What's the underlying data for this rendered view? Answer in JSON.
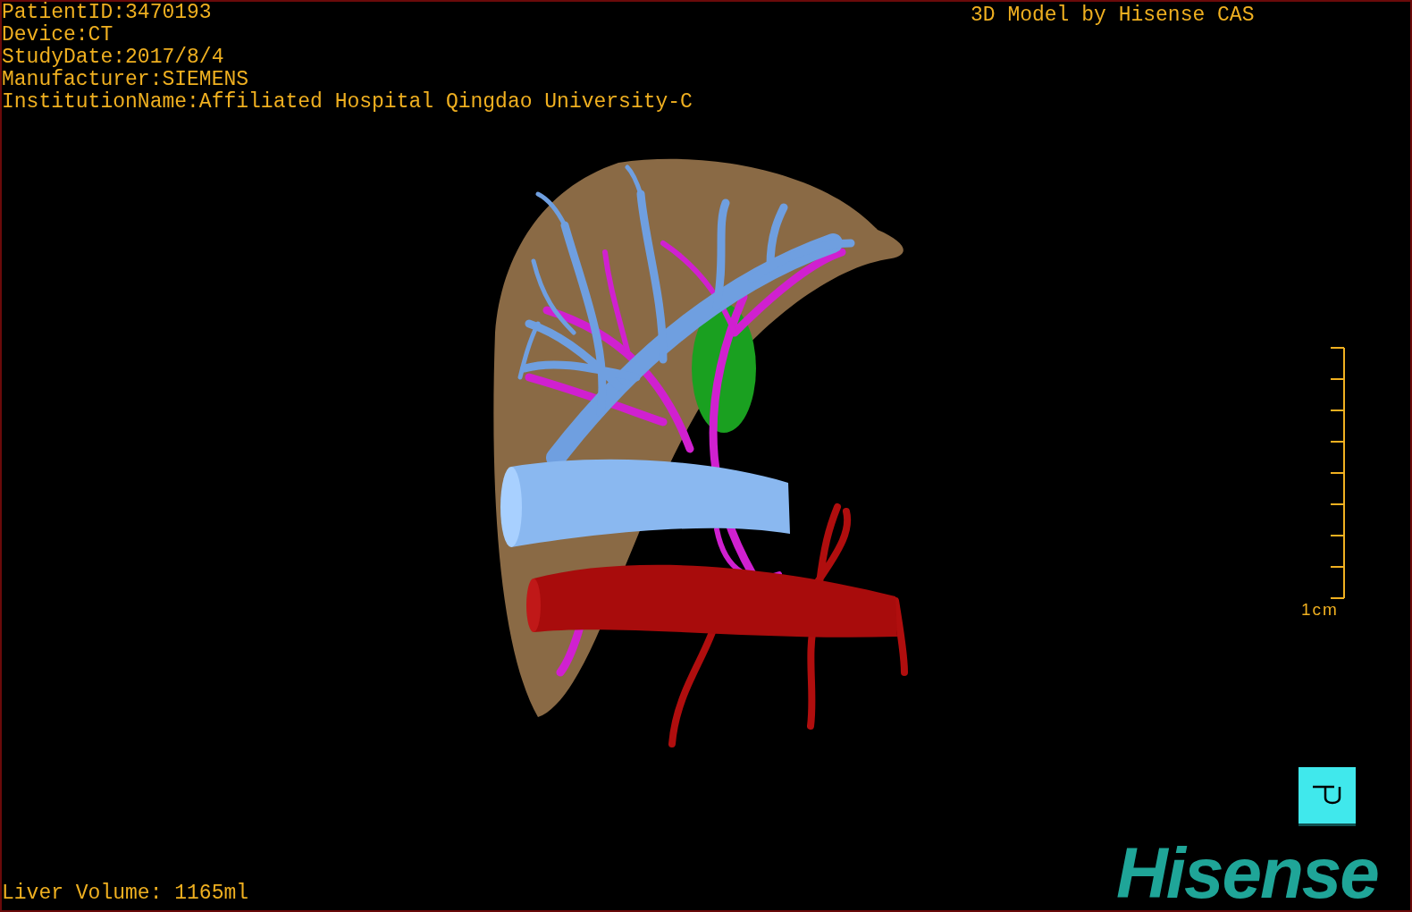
{
  "patient_info": [
    "PatientID:3470193",
    "Device:CT",
    "StudyDate:2017/8/4",
    "Manufacturer:SIEMENS",
    "InstitutionName:Affiliated Hospital Qingdao University-C"
  ],
  "title": "3D Model by Hisense CAS",
  "scale_bar": {
    "label": "1cm"
  },
  "liver_volume": "Liver Volume: 1165ml",
  "brand_logo": "Hisense"
}
